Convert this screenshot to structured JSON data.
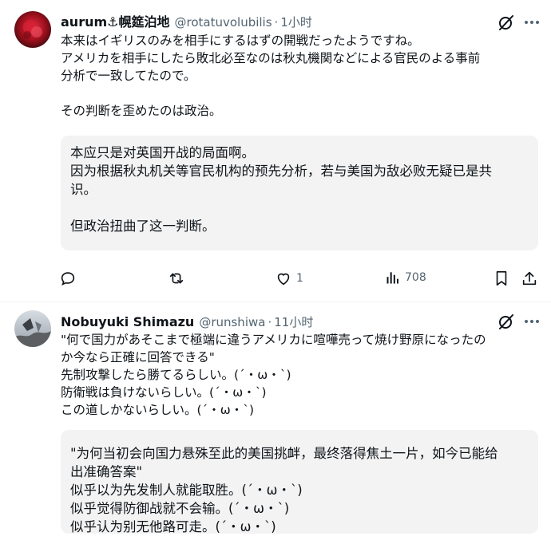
{
  "posts": [
    {
      "author_name": "aurum⚓幌筵泊地",
      "handle": "@rotatuvolubilis",
      "separator": "·",
      "time": "1小时",
      "body_lines": [
        "本来はイギリスのみを相手にするはずの開戦だったようですね。",
        "アメリカを相手にしたら敗北必至なのは秋丸機関などによる官民のよる事前",
        "分析で一致してたので。",
        "",
        "その判断を歪めたのは政治。"
      ],
      "translation_lines": [
        "本应只是对英国开战的局面啊。",
        "因为根据秋丸机关等官民机构的预先分析，若与美国为敌必败无疑已是共",
        "识。",
        "",
        "但政治扭曲了这一判断。"
      ],
      "actions": {
        "reply_count": "",
        "repost_count": "",
        "like_count": "1",
        "views_count": "708"
      }
    },
    {
      "author_name": "Nobuyuki Shimazu",
      "handle": "@runshiwa",
      "separator": "·",
      "time": "11小时",
      "body_lines": [
        "\"何で国力があそこまで極端に違うアメリカに喧嘩売って焼け野原になったの",
        "か今なら正確に回答できる\"",
        "先制攻撃したら勝てるらしい。(´・ω・`)",
        "防衛戦は負けないらしい。(´・ω・`)",
        "この道しかないらしい。(´・ω・`)"
      ],
      "translation_lines": [
        "\"为何当初会向国力悬殊至此的美国挑衅，最终落得焦土一片，如今已能给",
        "出准确答案\"",
        "似乎以为先发制人就能取胜。(´・ω・`)",
        "似乎觉得防御战就不会输。(´・ω・`)",
        "似乎认为别无他路可走。(´・ω・`)"
      ]
    }
  ],
  "icons": {
    "reply": "reply-icon",
    "repost": "repost-icon",
    "like": "heart-icon",
    "views": "views-icon",
    "bookmark": "bookmark-icon",
    "share": "share-icon",
    "grok": "grok-icon"
  },
  "colors": {
    "text": "#0f1419",
    "secondary": "#536471",
    "translation_bg": "#f3f3f3"
  }
}
